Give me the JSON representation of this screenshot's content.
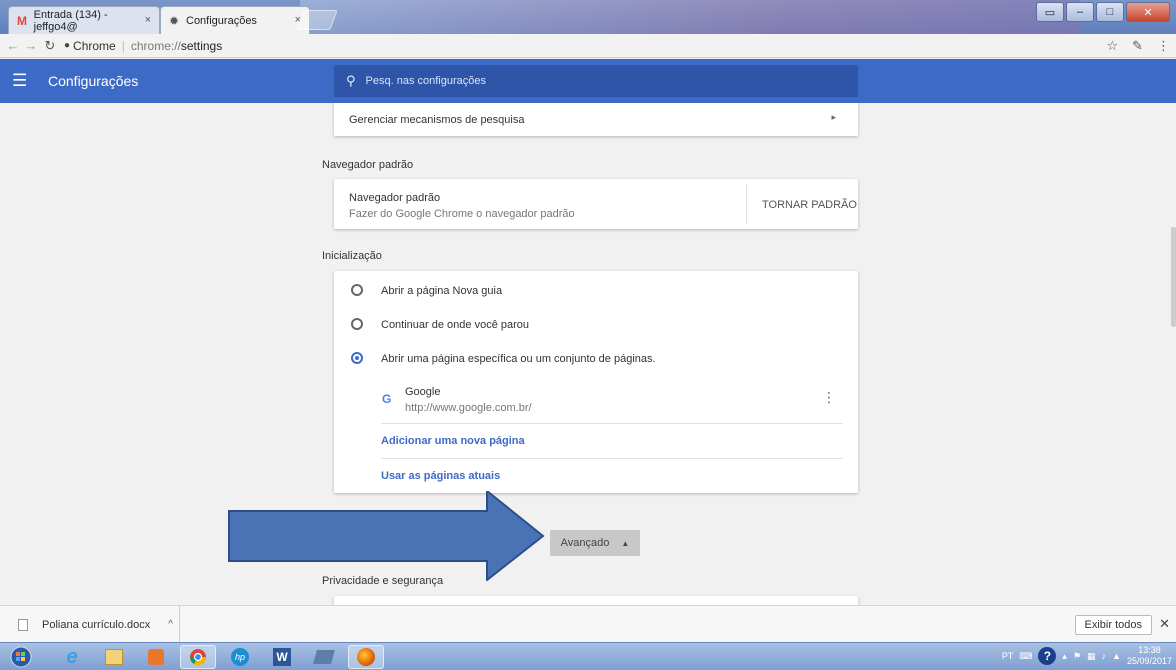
{
  "browser": {
    "tabs": [
      {
        "label": "Entrada (134) - jeffgo4@"
      },
      {
        "label": "Configurações"
      }
    ],
    "address": {
      "chip": "Chrome",
      "url_scheme": "chrome://",
      "url_path": "settings"
    }
  },
  "settings": {
    "header_title": "Configurações",
    "search_placeholder": "Pesq. nas configurações",
    "manage_search_engines": "Gerenciar mecanismos de pesquisa",
    "default_browser": {
      "section_title": "Navegador padrão",
      "row_title": "Navegador padrão",
      "row_subtitle": "Fazer do Google Chrome o navegador padrão",
      "action": "TORNAR PADRÃO"
    },
    "startup": {
      "section_title": "Inicialização",
      "options": [
        {
          "label": "Abrir a página Nova guia",
          "selected": false
        },
        {
          "label": "Continuar de onde você parou",
          "selected": false
        },
        {
          "label": "Abrir uma página específica ou um conjunto de páginas.",
          "selected": true
        }
      ],
      "page": {
        "name": "Google",
        "url": "http://www.google.com.br/"
      },
      "add_page": "Adicionar uma nova página",
      "use_current": "Usar as páginas atuais"
    },
    "advanced_button": "Avançado",
    "privacy_section_title": "Privacidade e segurança"
  },
  "downloads": {
    "file_name": "Poliana currículo.docx",
    "show_all": "Exibir todos"
  },
  "taskbar": {
    "language": "PT",
    "time": "13:38",
    "date": "25/09/2017"
  },
  "colors": {
    "accent": "#3e6ac7",
    "header_bg": "#3e6ac7",
    "search_bg": "#2f55a8",
    "arrow_fill": "#4a73b6"
  }
}
